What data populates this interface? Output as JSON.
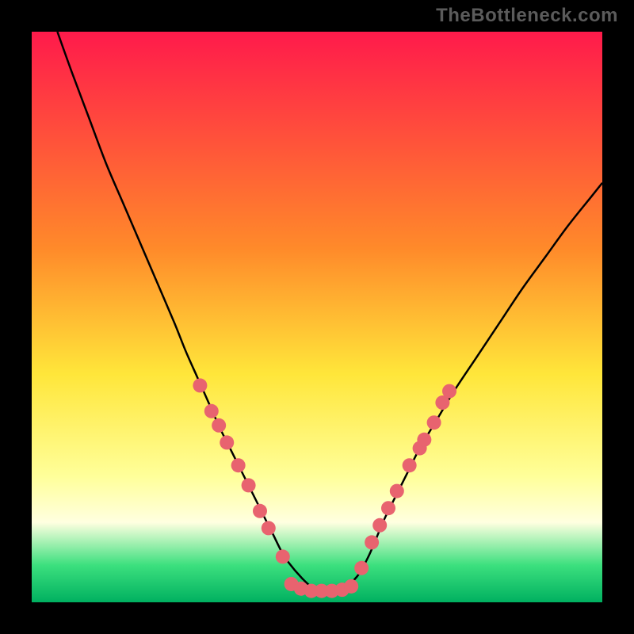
{
  "watermark": "TheBottleneck.com",
  "chart_data": {
    "type": "line",
    "title": "",
    "xlabel": "",
    "ylabel": "",
    "xlim": [
      0,
      100
    ],
    "ylim": [
      0,
      100
    ],
    "background_gradient": {
      "stops": [
        {
          "offset": 0.0,
          "color": "#ff1a4b"
        },
        {
          "offset": 0.38,
          "color": "#ff8a2a"
        },
        {
          "offset": 0.6,
          "color": "#ffe63a"
        },
        {
          "offset": 0.78,
          "color": "#ffff9a"
        },
        {
          "offset": 0.86,
          "color": "#ffffe0"
        },
        {
          "offset": 0.935,
          "color": "#3ce07e"
        },
        {
          "offset": 1.0,
          "color": "#00b060"
        }
      ]
    },
    "series": [
      {
        "name": "curve",
        "color": "#000000",
        "stroke_width": 2.5,
        "x": [
          4.5,
          7,
          10,
          13,
          16,
          19,
          22,
          25,
          27,
          29,
          31,
          33,
          35,
          37,
          39.5,
          42,
          45,
          50,
          54,
          57,
          59,
          60.5,
          62,
          64,
          66,
          68,
          71,
          74,
          78,
          82,
          86,
          90,
          94,
          98,
          100
        ],
        "y": [
          100,
          93,
          85,
          77,
          70,
          63,
          56,
          49,
          44,
          39.5,
          35,
          30.5,
          26.5,
          22.5,
          17.5,
          12.5,
          7,
          2,
          2,
          4.5,
          8,
          11.5,
          15,
          19,
          23,
          27,
          32,
          37,
          43,
          49,
          55,
          60.5,
          66,
          71,
          73.5
        ]
      }
    ],
    "marker_groups": [
      {
        "name": "left-dots",
        "color": "#e8636f",
        "radius": 9,
        "points": [
          {
            "x": 29.5,
            "y": 38
          },
          {
            "x": 31.5,
            "y": 33.5
          },
          {
            "x": 32.8,
            "y": 31
          },
          {
            "x": 34.2,
            "y": 28
          },
          {
            "x": 36.2,
            "y": 24
          },
          {
            "x": 38.0,
            "y": 20.5
          },
          {
            "x": 40.0,
            "y": 16
          },
          {
            "x": 41.5,
            "y": 13
          },
          {
            "x": 44.0,
            "y": 8
          }
        ]
      },
      {
        "name": "right-dots",
        "color": "#e8636f",
        "radius": 9,
        "points": [
          {
            "x": 57.8,
            "y": 6
          },
          {
            "x": 59.6,
            "y": 10.5
          },
          {
            "x": 61.0,
            "y": 13.5
          },
          {
            "x": 62.5,
            "y": 16.5
          },
          {
            "x": 64.0,
            "y": 19.5
          },
          {
            "x": 66.2,
            "y": 24
          },
          {
            "x": 68.0,
            "y": 27
          },
          {
            "x": 68.8,
            "y": 28.5
          },
          {
            "x": 70.5,
            "y": 31.5
          },
          {
            "x": 72.0,
            "y": 35
          },
          {
            "x": 73.2,
            "y": 37
          }
        ]
      },
      {
        "name": "bottom-dots",
        "color": "#e8636f",
        "radius": 9,
        "points": [
          {
            "x": 45.5,
            "y": 3.2
          },
          {
            "x": 47.2,
            "y": 2.4
          },
          {
            "x": 49.0,
            "y": 2.0
          },
          {
            "x": 50.8,
            "y": 2.0
          },
          {
            "x": 52.6,
            "y": 2.0
          },
          {
            "x": 54.4,
            "y": 2.2
          },
          {
            "x": 56.0,
            "y": 2.8
          }
        ]
      }
    ]
  }
}
